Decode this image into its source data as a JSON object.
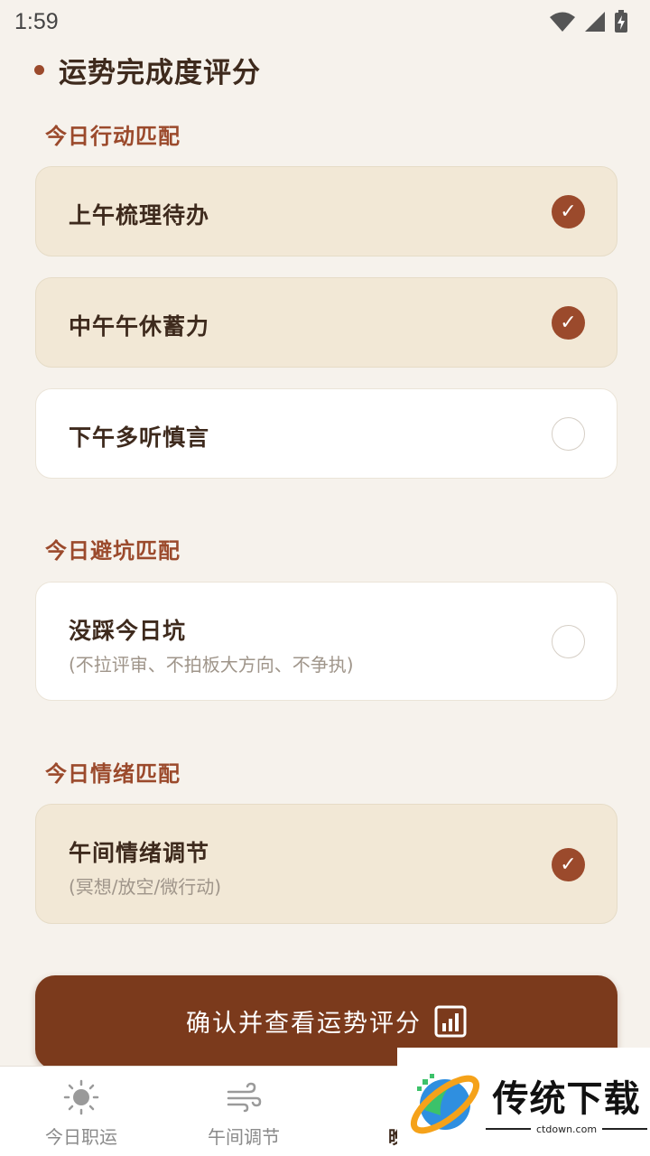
{
  "status": {
    "time": "1:59"
  },
  "header": {
    "title": "运势完成度评分"
  },
  "groups": {
    "actions": {
      "label": "今日行动匹配"
    },
    "pitfalls": {
      "label": "今日避坑匹配"
    },
    "emotions": {
      "label": "今日情绪匹配"
    }
  },
  "items": [
    {
      "title": "上午梳理待办",
      "checked": true,
      "check_glyph": "✓"
    },
    {
      "title": "中午午休蓄力",
      "checked": true,
      "check_glyph": "✓"
    },
    {
      "title": "下午多听慎言",
      "checked": false,
      "check_glyph": ""
    },
    {
      "title": "没踩今日坑",
      "subtitle": "(不拉评审、不拍板大方向、不争执)",
      "checked": false,
      "check_glyph": ""
    },
    {
      "title": "午间情绪调节",
      "subtitle": "(冥想/放空/微行动)",
      "checked": true,
      "check_glyph": "✓"
    }
  ],
  "confirm": {
    "label": "确认并查看运势评分",
    "icon": "bar-chart-icon"
  },
  "nav": [
    {
      "label": "今日职运",
      "icon": "sun-icon"
    },
    {
      "label": "午间调节",
      "icon": "wind-icon"
    },
    {
      "label": "晚间",
      "icon": "moon-icon"
    }
  ],
  "watermark": {
    "title": "传统下载",
    "url": "ctdown.com"
  },
  "colors": {
    "accent": "#9b4a2c",
    "button": "#7b3a1c",
    "checked_card": "#f2e8d6",
    "background": "#f6f2ec"
  }
}
